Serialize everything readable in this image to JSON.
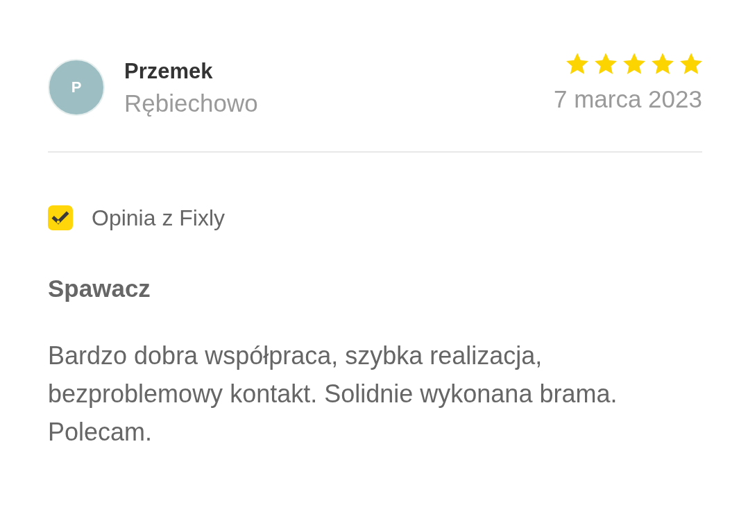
{
  "review": {
    "author": {
      "initial": "P",
      "name": "Przemek",
      "location": "Rębiechowo"
    },
    "stars": 5,
    "date": "7 marca 2023",
    "source": "Opinia z Fixly",
    "title": "Spawacz",
    "text": "Bardzo dobra współpraca, szybka realizacja, bezproblemowy kontakt. Solidnie wykonana brama. Polecam."
  }
}
